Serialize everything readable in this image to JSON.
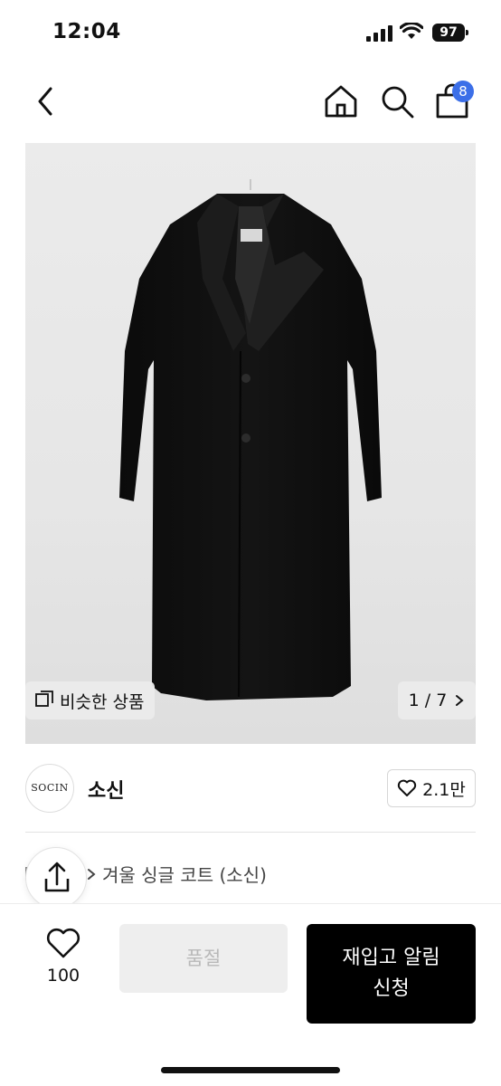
{
  "status_bar": {
    "time": "12:04",
    "battery": "97"
  },
  "nav": {
    "cart_badge": "8"
  },
  "product": {
    "similar_label": "비슷한 상품",
    "image_index": "1 / 7",
    "breadcrumb": "겨울 싱글 코트 (소신)"
  },
  "store": {
    "logo_text": "SOCIN",
    "name": "소신",
    "likes": "2.1만"
  },
  "bottom": {
    "wish_count": "100",
    "soldout_label": "품절",
    "restock_line1": "재입고 알림",
    "restock_line2": "신청"
  },
  "colors": {
    "accent_badge": "#3c6fe8",
    "primary_button": "#000000",
    "disabled_button": "#eeeeee"
  }
}
